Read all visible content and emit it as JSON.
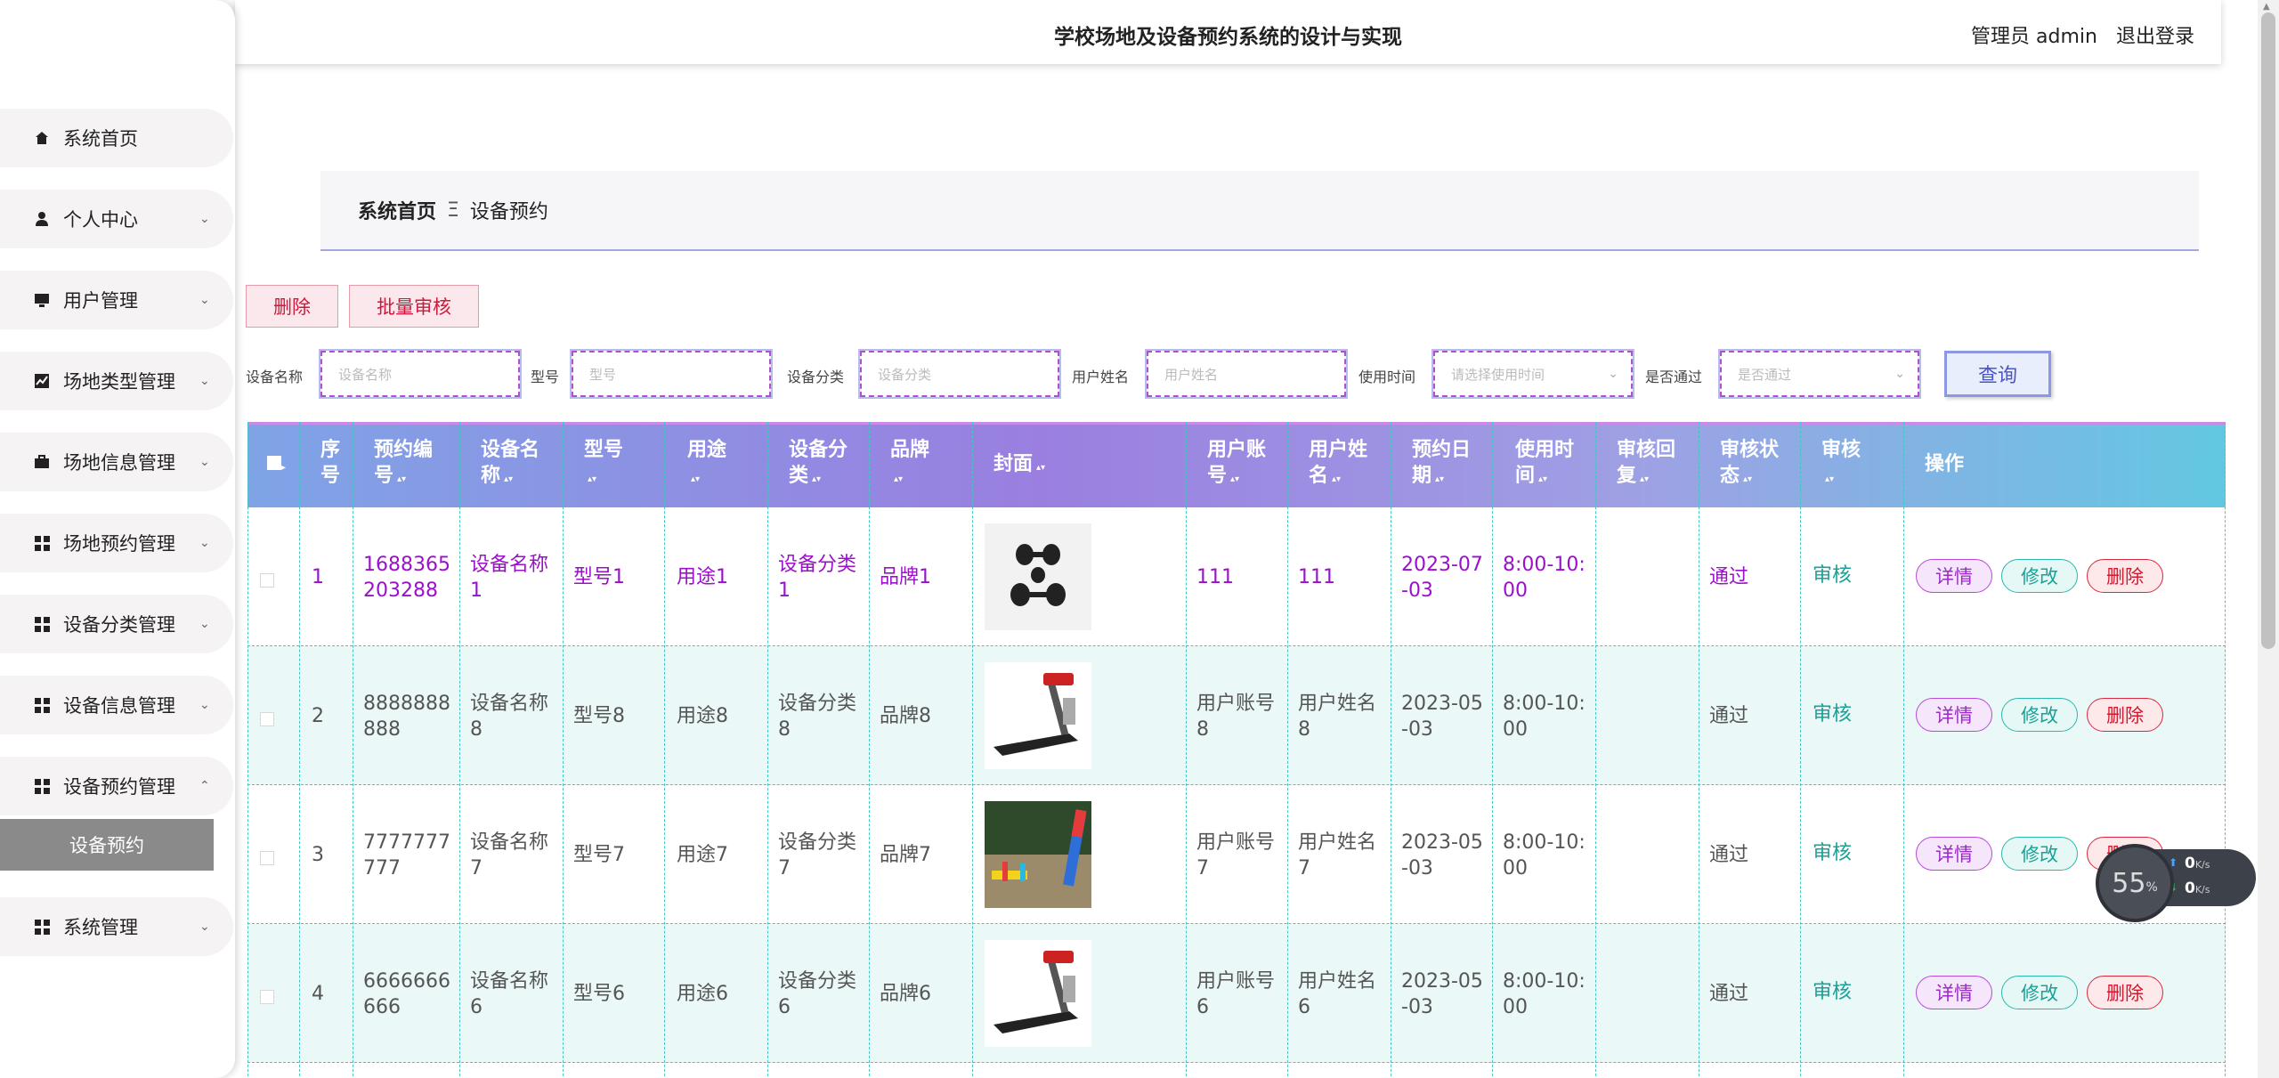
{
  "header": {
    "title": "学校场地及设备预约系统的设计与实现",
    "user": "管理员 admin",
    "logout": "退出登录"
  },
  "sidebar": {
    "items": [
      {
        "label": "系统首页",
        "icon": "home-icon",
        "arrow": ""
      },
      {
        "label": "个人中心",
        "icon": "user-icon",
        "arrow": "⌄"
      },
      {
        "label": "用户管理",
        "icon": "monitor-icon",
        "arrow": "⌄"
      },
      {
        "label": "场地类型管理",
        "icon": "chart-icon",
        "arrow": "⌄"
      },
      {
        "label": "场地信息管理",
        "icon": "briefcase-icon",
        "arrow": "⌄"
      },
      {
        "label": "场地预约管理",
        "icon": "grid-icon",
        "arrow": "⌄"
      },
      {
        "label": "设备分类管理",
        "icon": "grid-icon",
        "arrow": "⌄"
      },
      {
        "label": "设备信息管理",
        "icon": "grid-icon",
        "arrow": "⌄"
      },
      {
        "label": "设备预约管理",
        "icon": "grid-icon",
        "arrow": "⌃"
      },
      {
        "label": "系统管理",
        "icon": "grid-icon",
        "arrow": "⌄"
      }
    ],
    "sub_item": "设备预约"
  },
  "breadcrumb": {
    "home": "系统首页",
    "sep": "Ξ",
    "current": "设备预约"
  },
  "actions": {
    "delete": "删除",
    "batch_review": "批量审核",
    "query": "查询"
  },
  "search": {
    "fields": [
      {
        "label": "设备名称",
        "placeholder": "设备名称"
      },
      {
        "label": "型号",
        "placeholder": "型号"
      },
      {
        "label": "设备分类",
        "placeholder": "设备分类"
      },
      {
        "label": "用户姓名",
        "placeholder": "用户姓名"
      },
      {
        "label": "使用时间",
        "placeholder": "请选择使用时间",
        "dropdown": true
      },
      {
        "label": "是否通过",
        "placeholder": "是否通过",
        "dropdown": true
      }
    ]
  },
  "table": {
    "headers": [
      {
        "l1": "■",
        "l2": ""
      },
      {
        "l1": "序",
        "l2": "号"
      },
      {
        "l1": "预约编",
        "l2": "号"
      },
      {
        "l1": "设备名",
        "l2": "称"
      },
      {
        "l1": "型号",
        "l2": ""
      },
      {
        "l1": "用途",
        "l2": ""
      },
      {
        "l1": "设备分",
        "l2": "类"
      },
      {
        "l1": "品牌",
        "l2": ""
      },
      {
        "l1": "封面",
        "l2": ""
      },
      {
        "l1": "用户账",
        "l2": "号"
      },
      {
        "l1": "用户姓",
        "l2": "名"
      },
      {
        "l1": "预约日",
        "l2": "期"
      },
      {
        "l1": "使用时",
        "l2": "间"
      },
      {
        "l1": "审核回",
        "l2": "复"
      },
      {
        "l1": "审核状",
        "l2": "态"
      },
      {
        "l1": "审核",
        "l2": ""
      },
      {
        "l1": "操作",
        "l2": ""
      }
    ],
    "rows": [
      {
        "idx": "1",
        "code1": "1688365",
        "code2": "203288",
        "name1": "设备名称",
        "name2": "1",
        "model": "型号1",
        "use": "用途1",
        "cat1": "设备分类",
        "cat2": "1",
        "brand": "品牌1",
        "image": "dumbbells",
        "acc1": "111",
        "acc2": "",
        "uname1": "111",
        "uname2": "",
        "date1": "2023-07",
        "date2": "-03",
        "time1": "8:00-10:",
        "time2": "00",
        "reply": "",
        "status": "通过",
        "review": "审核"
      },
      {
        "idx": "2",
        "code1": "8888888",
        "code2": "888",
        "name1": "设备名称",
        "name2": "8",
        "model": "型号8",
        "use": "用途8",
        "cat1": "设备分类",
        "cat2": "8",
        "brand": "品牌8",
        "image": "treadmill",
        "acc1": "用户账号",
        "acc2": "8",
        "uname1": "用户姓名",
        "uname2": "8",
        "date1": "2023-05",
        "date2": "-03",
        "time1": "8:00-10:",
        "time2": "00",
        "reply": "",
        "status": "通过",
        "review": "审核"
      },
      {
        "idx": "3",
        "code1": "7777777",
        "code2": "777",
        "name1": "设备名称",
        "name2": "7",
        "model": "型号7",
        "use": "用途7",
        "cat1": "设备分类",
        "cat2": "7",
        "brand": "品牌7",
        "image": "training-poles",
        "acc1": "用户账号",
        "acc2": "7",
        "uname1": "用户姓名",
        "uname2": "7",
        "date1": "2023-05",
        "date2": "-03",
        "time1": "8:00-10:",
        "time2": "00",
        "reply": "",
        "status": "通过",
        "review": "审核"
      },
      {
        "idx": "4",
        "code1": "6666666",
        "code2": "666",
        "name1": "设备名称",
        "name2": "6",
        "model": "型号6",
        "use": "用途6",
        "cat1": "设备分类",
        "cat2": "6",
        "brand": "品牌6",
        "image": "treadmill",
        "acc1": "用户账号",
        "acc2": "6",
        "uname1": "用户姓名",
        "uname2": "6",
        "date1": "2023-05",
        "date2": "-03",
        "time1": "8:00-10:",
        "time2": "00",
        "reply": "",
        "status": "通过",
        "review": "审核"
      }
    ],
    "row_buttons": {
      "detail": "详情",
      "edit": "修改",
      "delete": "删除"
    }
  },
  "net_widget": {
    "percent": "55",
    "percent_unit": "%",
    "up": "0",
    "down": "0",
    "unit": "K/s"
  },
  "colors": {
    "first_row_text": "#9a11c9",
    "review_link": "#16a297",
    "normal_text": "#555555"
  }
}
